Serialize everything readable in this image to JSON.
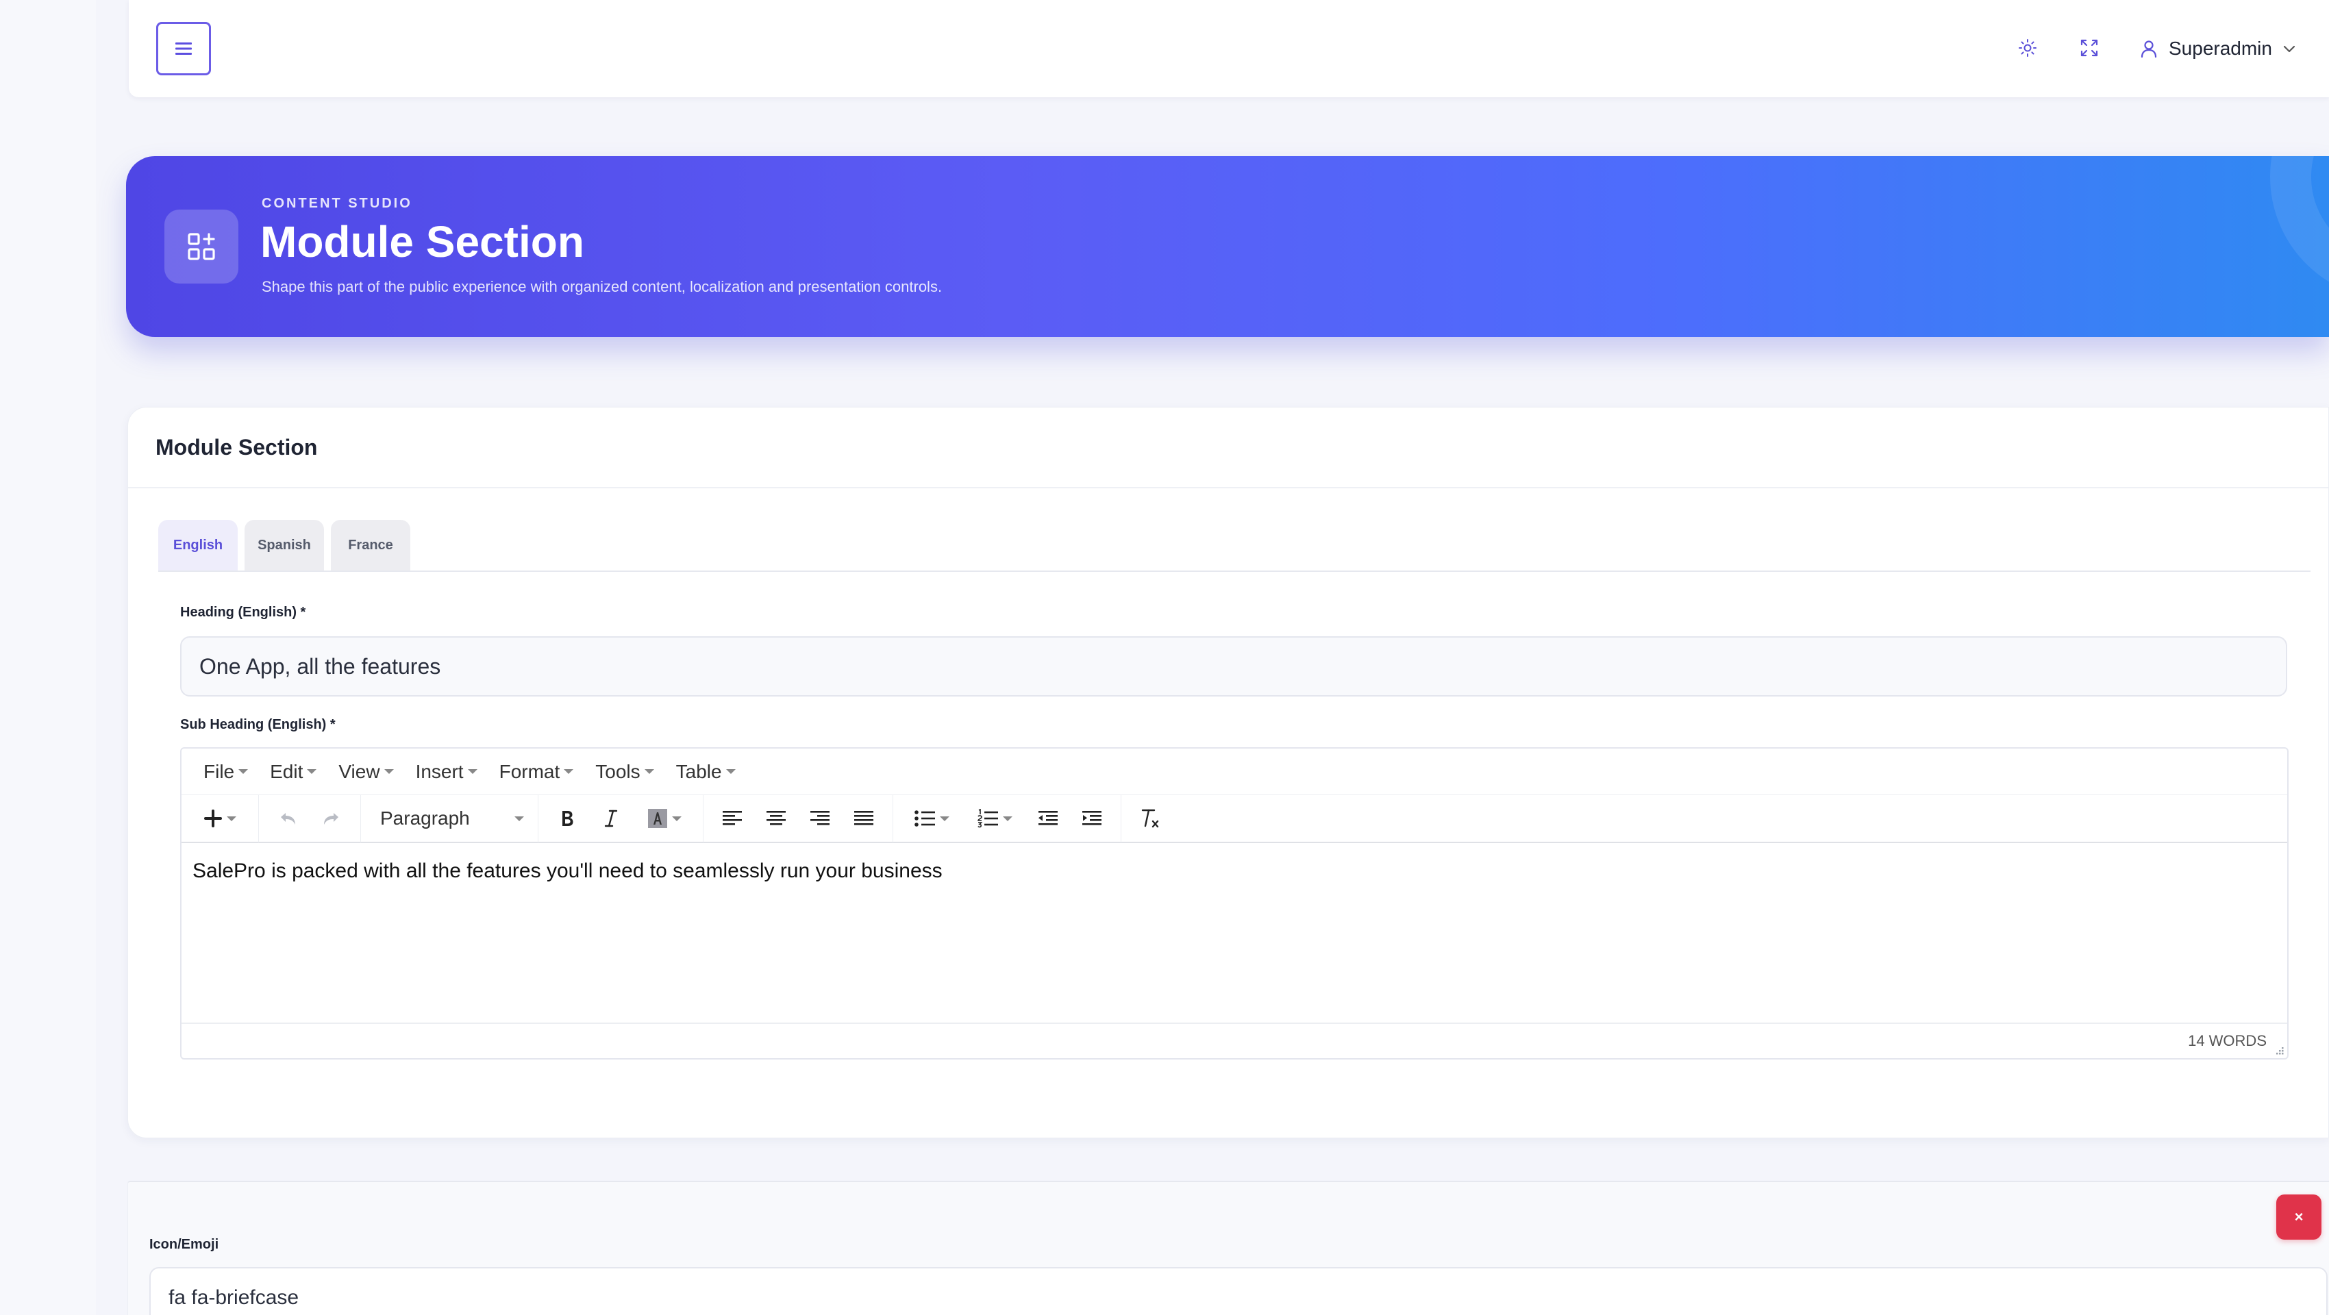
{
  "topbar": {
    "menu_icon": "hamburger-icon",
    "theme_icon": "sun-icon",
    "fullscreen_icon": "expand-icon",
    "user": {
      "icon": "user-icon",
      "name": "Superadmin",
      "dropdown_icon": "chevron-down-icon"
    }
  },
  "hero": {
    "icon": "grid-plus-icon",
    "eyebrow": "CONTENT STUDIO",
    "title": "Module Section",
    "subtitle": "Shape this part of the public experience with organized content, localization and presentation controls."
  },
  "card": {
    "title": "Module Section",
    "tabs": [
      {
        "label": "English",
        "active": true
      },
      {
        "label": "Spanish",
        "active": false
      },
      {
        "label": "France",
        "active": false
      }
    ],
    "heading_label": "Heading (English) *",
    "heading_value": "One App, all the features",
    "subheading_label": "Sub Heading (English) *",
    "editor": {
      "menus": [
        "File",
        "Edit",
        "View",
        "Insert",
        "Format",
        "Tools",
        "Table"
      ],
      "format_select": "Paragraph",
      "content": "SalePro is packed with all the features you'll need to seamlessly run your business",
      "word_count": "14 WORDS"
    }
  },
  "item": {
    "close_label": "×",
    "icon_label": "Icon/Emoji",
    "icon_value": "fa fa-briefcase"
  },
  "colors": {
    "accent": "#5a4fd8",
    "danger": "#e0334a",
    "hero_start": "#4f46e5",
    "hero_end": "#2f8af2"
  }
}
